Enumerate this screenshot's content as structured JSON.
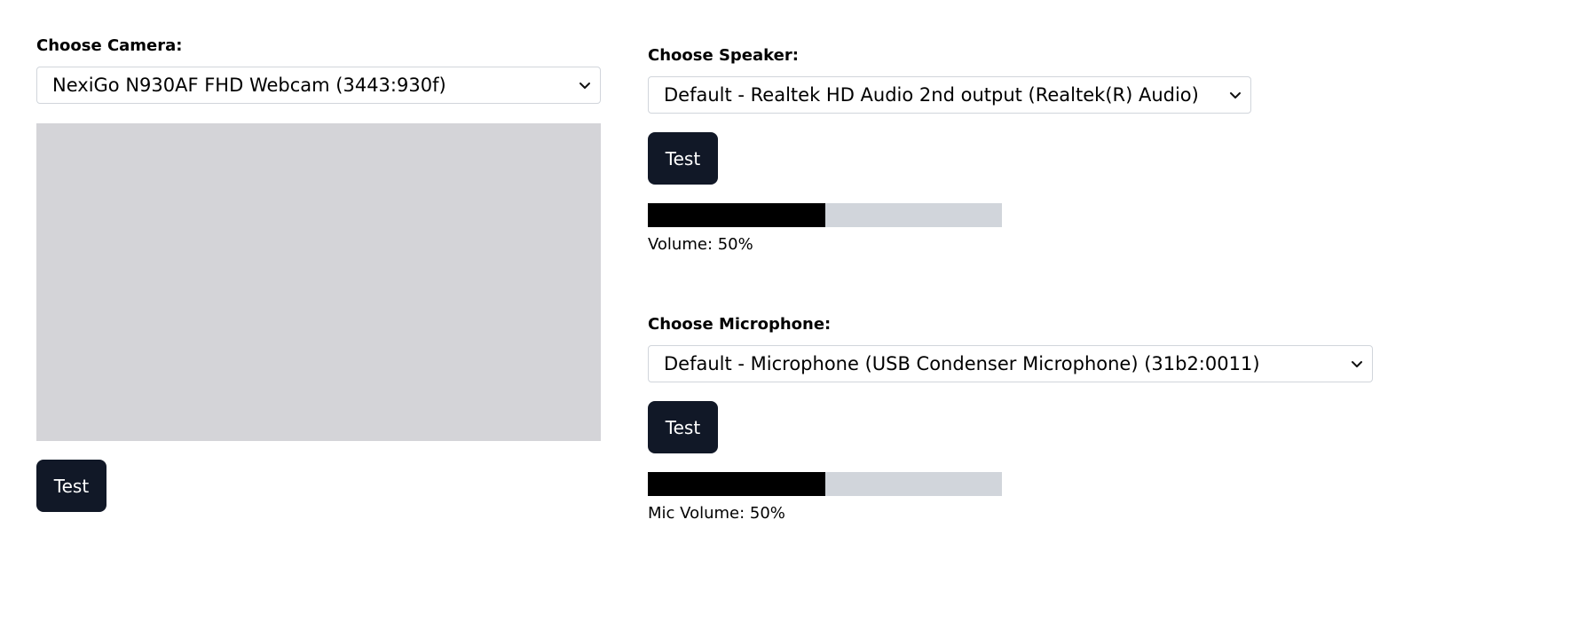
{
  "camera": {
    "label": "Choose Camera:",
    "selected": "NexiGo N930AF FHD Webcam (3443:930f)",
    "test_label": "Test"
  },
  "speaker": {
    "label": "Choose Speaker:",
    "selected": "Default - Realtek HD Audio 2nd output (Realtek(R) Audio)",
    "test_label": "Test",
    "volume_text": "Volume: 50%",
    "volume_level": 0.5
  },
  "microphone": {
    "label": "Choose Microphone:",
    "selected": "Default - Microphone (USB Condenser Microphone) (31b2:0011)",
    "test_label": "Test",
    "volume_text": "Mic Volume: 50%",
    "volume_level": 0.5
  },
  "colors": {
    "button_bg": "#111827",
    "meter_track": "#d1d5db",
    "meter_fill": "#000000",
    "video_placeholder": "#d4d4d8"
  }
}
